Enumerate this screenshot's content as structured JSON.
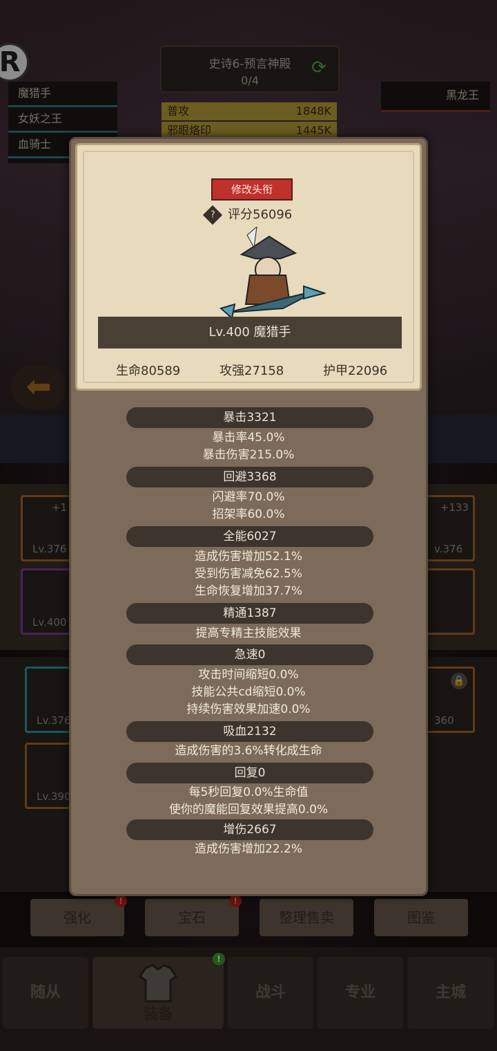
{
  "stage": {
    "name": "史诗6-预言神殿",
    "progress": "0/4"
  },
  "party": [
    "魔猎手",
    "女妖之王",
    "血骑士"
  ],
  "enemy": "黑龙王",
  "skills": [
    {
      "name": "普攻",
      "value": "1848K"
    },
    {
      "name": "邪眼烙印",
      "value": "1445K"
    }
  ],
  "popup": {
    "title_button": "修改头衔",
    "score": "评分56096",
    "hero_name": "Lv.400 魔猎手",
    "attributes": {
      "hp": "生命80589",
      "atk": "攻强27158",
      "armor": "护甲22096"
    },
    "stats": [
      {
        "head": "暴击3321",
        "lines": [
          "暴击率45.0%",
          "暴击伤害215.0%"
        ]
      },
      {
        "head": "回避3368",
        "lines": [
          "闪避率70.0%",
          "招架率60.0%"
        ]
      },
      {
        "head": "全能6027",
        "lines": [
          "造成伤害增加52.1%",
          "受到伤害减免62.5%",
          "生命恢复增加37.7%"
        ]
      },
      {
        "head": "精通1387",
        "lines": [
          "提高专精主技能效果"
        ]
      },
      {
        "head": "急速0",
        "lines": [
          "攻击时间缩短0.0%",
          "技能公共cd缩短0.0%",
          "持续伤害效果加速0.0%"
        ]
      },
      {
        "head": "吸血2132",
        "lines": [
          "造成伤害的3.6%转化成生命"
        ]
      },
      {
        "head": "回复0",
        "lines": [
          "每5秒回复0.0%生命值",
          "使你的魔能回复效果提高0.0%"
        ]
      },
      {
        "head": "增伤2667",
        "lines": [
          "造成伤害增加22.2%"
        ]
      }
    ]
  },
  "equip_slots": {
    "left": [
      {
        "lv": "Lv.376",
        "plus": "+1"
      },
      {
        "lv": "Lv.400",
        "plus": ""
      }
    ],
    "right": [
      {
        "lv": "v.376",
        "plus": "+133"
      },
      {
        "lv": "",
        "plus": ""
      }
    ],
    "inv_left": [
      {
        "lv": "Lv.376"
      },
      {
        "lv": "Lv.390"
      }
    ],
    "inv_right": [
      {
        "lv": "360"
      }
    ]
  },
  "action_buttons": [
    "强化",
    "宝石",
    "整理售卖",
    "图鉴"
  ],
  "tabs": [
    "随从",
    "装备",
    "战斗",
    "专业",
    "主城"
  ],
  "colors": {
    "accent_red": "#c0302c",
    "party_bar": "#2f7d88",
    "enemy_bar": "#8c2f2a",
    "skill_bar": "#b8a13a"
  }
}
